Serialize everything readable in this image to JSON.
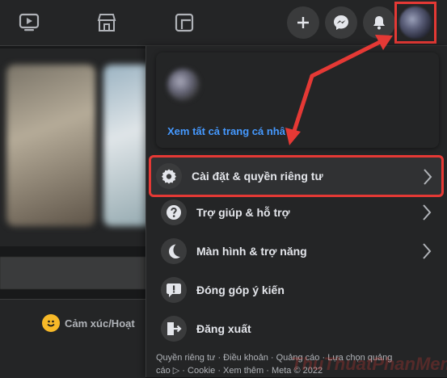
{
  "colors": {
    "accent": "#e53935",
    "link": "#4599ff",
    "panel": "#242526"
  },
  "topnav": {
    "icons": [
      "watch-icon",
      "marketplace-icon",
      "gaming-icon"
    ],
    "right_icons": [
      "plus-icon",
      "messenger-icon",
      "bell-icon"
    ]
  },
  "feed": {
    "feeling_label": "Cảm xúc/Hoạt"
  },
  "menu": {
    "see_profile": "Xem tất cả trang cá nhâ",
    "items": [
      {
        "label": "Cài đặt & quyền riêng tư",
        "icon": "gear-icon",
        "has_chevron": true
      },
      {
        "label": "Trợ giúp & hỗ trợ",
        "icon": "help-icon",
        "has_chevron": true
      },
      {
        "label": "Màn hình & trợ năng",
        "icon": "moon-icon",
        "has_chevron": true
      },
      {
        "label": "Đóng góp ý kiến",
        "icon": "feedback-icon",
        "has_chevron": false
      },
      {
        "label": "Đăng xuất",
        "icon": "logout-icon",
        "has_chevron": false
      }
    ],
    "footer_line1": "Quyền riêng tư · Điều khoản · Quảng cáo · Lựa chọn quảng",
    "footer_line2": "cáo ▷ · Cookie · Xem thêm · Meta © 2022"
  },
  "watermark": "ThuThuatPhanMem.vn"
}
